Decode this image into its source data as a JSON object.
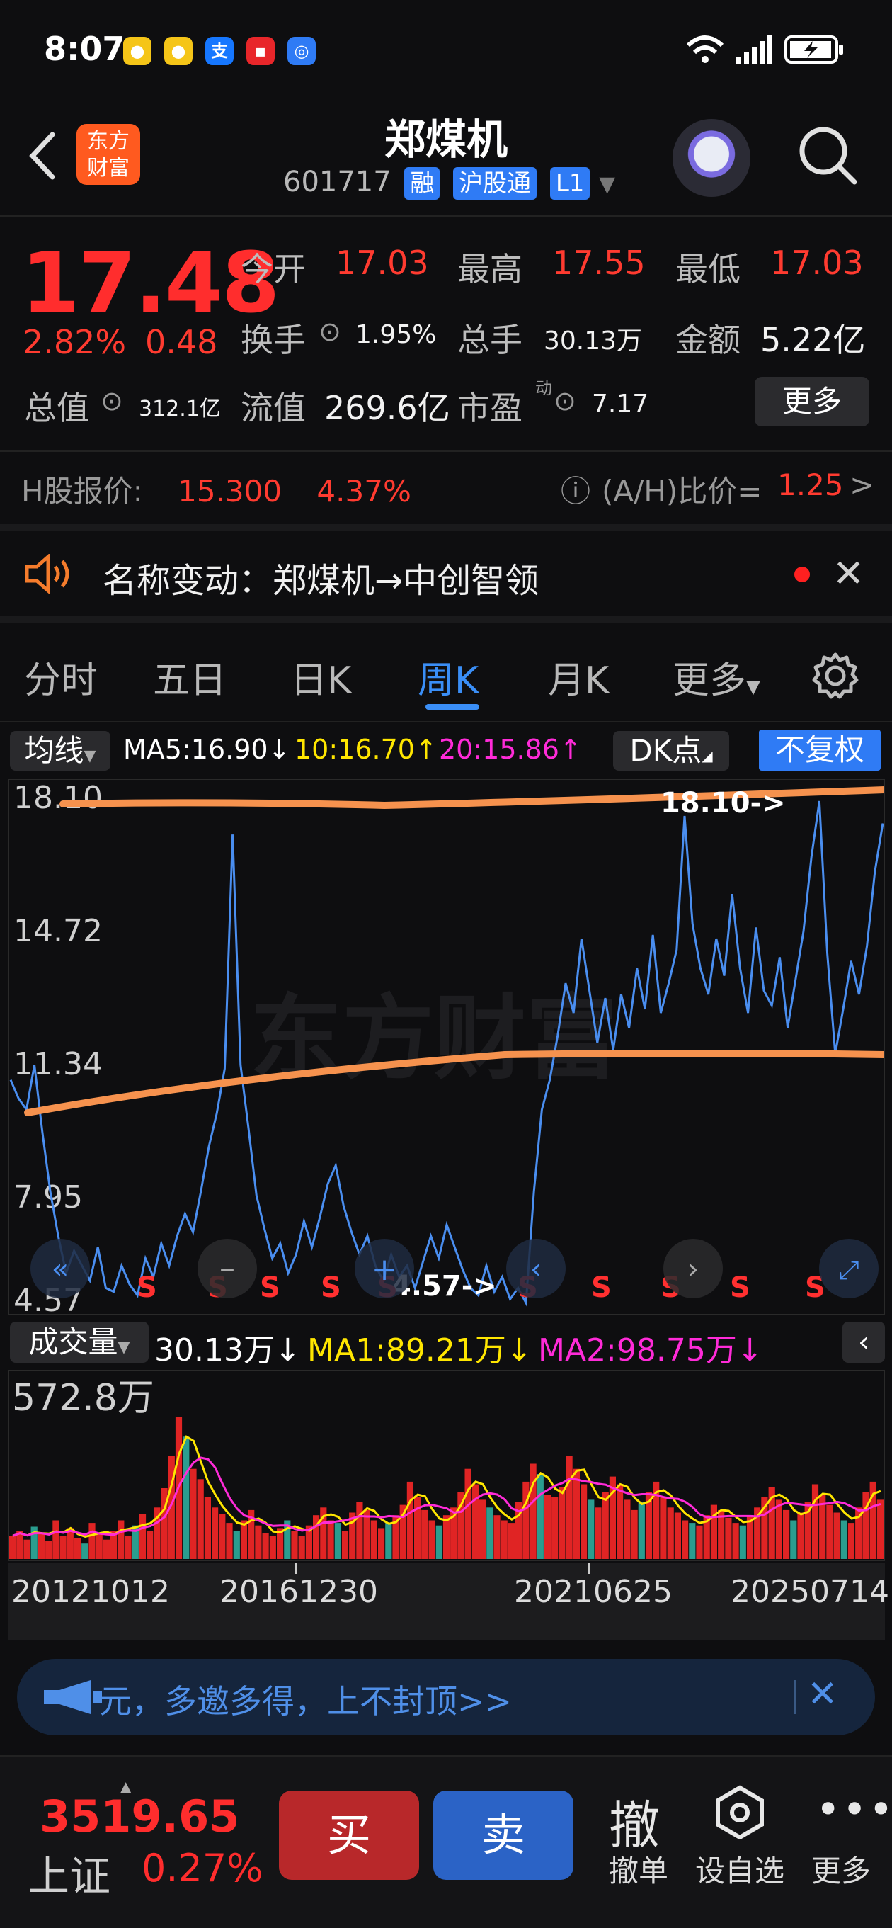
{
  "status_bar": {
    "time": "8:07",
    "battery_icon": "battery-charging-icon",
    "wifi_icon": "wifi-icon",
    "signal_icon": "signal-icon"
  },
  "header": {
    "title": "郑煤机",
    "code": "601717",
    "tags": [
      "融",
      "沪股通",
      "L1"
    ],
    "logo_text": [
      "东方",
      "财富"
    ]
  },
  "quote": {
    "price": "17.48",
    "change_pct": "2.82%",
    "change": "0.48",
    "fields": {
      "open_label": "今开",
      "open": "17.03",
      "high_label": "最高",
      "high": "17.55",
      "low_label": "最低",
      "low": "17.03",
      "turnover_label": "换手",
      "turnover": "1.95%",
      "volume_label": "总手",
      "volume": "30.13万",
      "amount_label": "金额",
      "amount": "5.22亿",
      "mktcap_label": "总值",
      "mktcap": "312.1亿",
      "float_label": "流值",
      "float": "269.6亿",
      "pe_label": "市盈",
      "pe_sup": "动",
      "pe": "7.17"
    },
    "more_label": "更多"
  },
  "hk": {
    "label": "H股报价:",
    "price": "15.300",
    "pct": "4.37%",
    "ratio_label": "(A/H)比价=",
    "ratio": "1.25",
    "arrow": ">"
  },
  "notice": {
    "text": "名称变动：郑煤机→中创智领"
  },
  "tabs": [
    "分时",
    "五日",
    "日K",
    "周K",
    "月K",
    "更多"
  ],
  "active_tab": "周K",
  "ma_bar": {
    "selector": "均线",
    "ma5": "MA5:16.90↓",
    "ma10": "10:16.70↑",
    "ma20": "20:15.86↑",
    "dk": "DK点",
    "fuquan": "不复权",
    "colors": {
      "ma5": "#ffffff",
      "ma10": "#ffe600",
      "ma20": "#ff2bd8"
    }
  },
  "chart_data": {
    "type": "line",
    "y_ticks": [
      "18.10",
      "14.72",
      "11.34",
      "7.95",
      "4.57"
    ],
    "ylim": [
      4.57,
      18.1
    ],
    "annotations": {
      "max": "18.10->",
      "min": "4.57->",
      "sell_marker": "S"
    },
    "sell_markers_count": 12,
    "series": [
      {
        "values": [
          10.6,
          10.1,
          9.8,
          11.0,
          9.2,
          7.6,
          6.4,
          5.4,
          6.0,
          5.6,
          5.2,
          6.1,
          5.0,
          4.9,
          5.6,
          5.1,
          4.8,
          5.8,
          5.3,
          6.2,
          5.6,
          6.4,
          7.0,
          6.5,
          7.6,
          8.8,
          9.7,
          10.9,
          17.2,
          11.0,
          9.3,
          7.5,
          6.6,
          5.8,
          6.2,
          5.4,
          5.9,
          6.8,
          6.1,
          6.9,
          7.8,
          8.3,
          7.2,
          6.5,
          5.9,
          6.4,
          5.6,
          5.2,
          5.9,
          5.3,
          5.6,
          5.0,
          5.7,
          6.4,
          5.8,
          6.7,
          6.1,
          5.5,
          5.0,
          4.8,
          5.6,
          4.9,
          5.3,
          4.7,
          5.0,
          4.6,
          7.6,
          9.8,
          10.6,
          11.8,
          13.2,
          12.4,
          14.4,
          13.0,
          11.6,
          12.8,
          11.4,
          12.9,
          12.0,
          13.6,
          12.5,
          14.5,
          12.4,
          13.2,
          14.1,
          17.7,
          14.8,
          13.6,
          12.9,
          14.4,
          13.4,
          15.6,
          13.6,
          12.4,
          14.7,
          13.0,
          12.6,
          13.9,
          12.0,
          13.3,
          14.6,
          16.6,
          18.1,
          14.0,
          11.3,
          12.5,
          13.8,
          12.9,
          14.2,
          16.2,
          17.5
        ],
        "x_first": "20121012",
        "x_last": "20250714"
      }
    ],
    "x_labels": [
      "20121012",
      "20161230",
      "20210625",
      "20250714"
    ],
    "trendline_color": "#f6924e",
    "line_color": "#4a8ef0",
    "watermark": "东方财富",
    "nav_icons": [
      "double-chevron-left-icon",
      "minus-icon",
      "plus-icon",
      "chevron-left-icon",
      "chevron-right-icon",
      "expand-icon"
    ]
  },
  "volume": {
    "selector": "成交量",
    "current": "30.13万↓",
    "ma1": "MA1:89.21万↓",
    "ma2": "MA2:98.75万↓",
    "max_label": "572.8万",
    "values": [
      18,
      22,
      15,
      25,
      20,
      14,
      30,
      18,
      24,
      16,
      12,
      28,
      20,
      15,
      22,
      30,
      18,
      26,
      35,
      22,
      40,
      55,
      80,
      110,
      95,
      70,
      62,
      48,
      40,
      35,
      28,
      22,
      30,
      38,
      26,
      20,
      18,
      24,
      30,
      22,
      18,
      26,
      34,
      40,
      30,
      28,
      22,
      36,
      44,
      38,
      30,
      24,
      28,
      34,
      42,
      60,
      48,
      38,
      30,
      26,
      34,
      40,
      52,
      70,
      58,
      46,
      40,
      34,
      30,
      28,
      44,
      60,
      74,
      66,
      50,
      48,
      56,
      80,
      70,
      58,
      46,
      40,
      52,
      64,
      58,
      46,
      38,
      44,
      52,
      60,
      48,
      40,
      36,
      30,
      28,
      26,
      34,
      42,
      38,
      32,
      28,
      26,
      34,
      40,
      48,
      56,
      46,
      38,
      30,
      36,
      44,
      58,
      50,
      42,
      36,
      30,
      28,
      40,
      52,
      60,
      46
    ],
    "colors": {
      "bar": "#e02424",
      "ma1": "#ffe600",
      "ma2": "#ff2bd8"
    }
  },
  "ad": {
    "text": "元，多邀多得，上不封顶>>"
  },
  "bottom_bar": {
    "index_value": "3519.65",
    "index_name": "上证",
    "index_pct": "0.27%",
    "buy": "买",
    "sell": "卖",
    "cancel_glyph": "撤",
    "cancel_label": "撤单",
    "watchlist_label": "设自选",
    "more_label": "更多"
  }
}
